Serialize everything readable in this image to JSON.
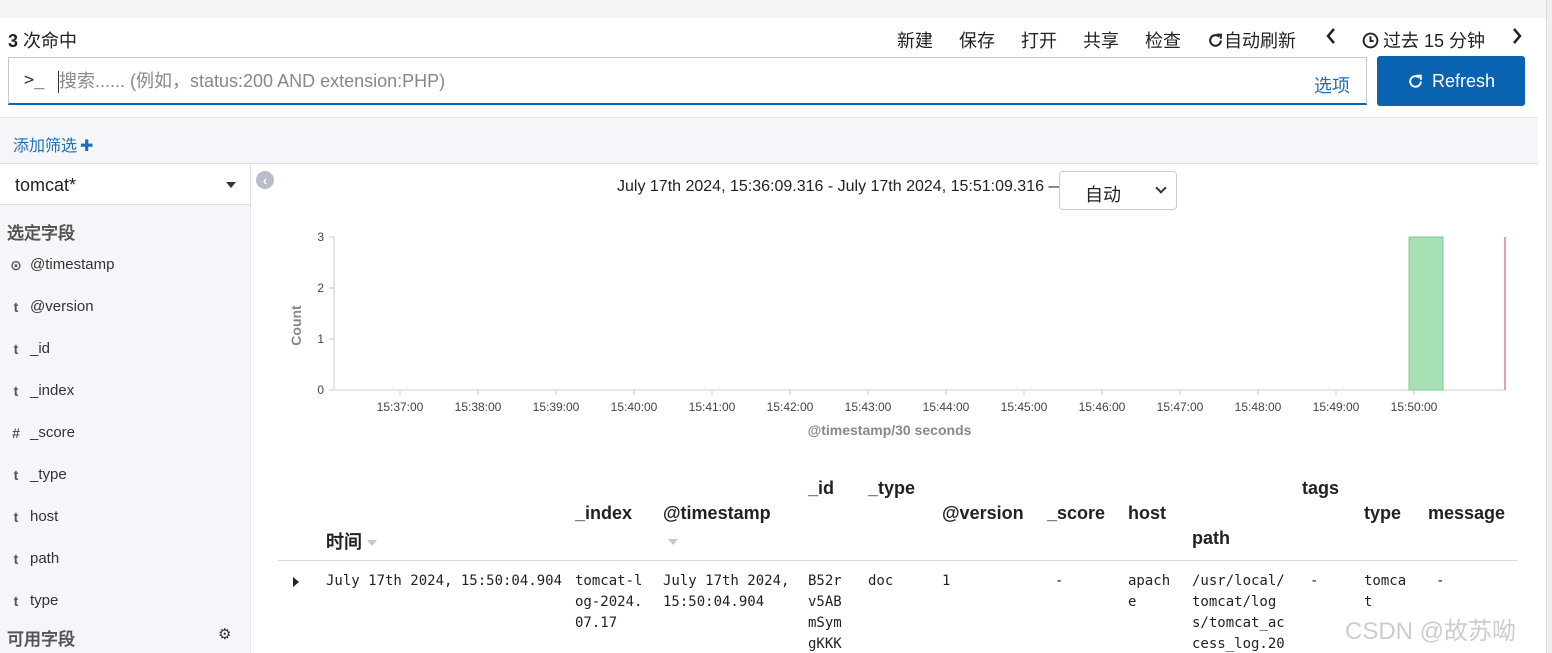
{
  "header": {
    "hits_count": "3",
    "hits_label": " 次命中",
    "menu": {
      "new": "新建",
      "save": "保存",
      "open": "打开",
      "share": "共享",
      "inspect": "检查",
      "auto_refresh": "自动刷新",
      "time_range": "过去 15 分钟"
    }
  },
  "search": {
    "prompt": ">_",
    "placeholder": "搜索...... (例如，status:200 AND extension:PHP)",
    "value": "",
    "options_label": "选项",
    "refresh_label": "Refresh"
  },
  "filters": {
    "add_label": "添加筛选",
    "add_icon": "plus-icon"
  },
  "sidebar": {
    "index_pattern": "tomcat*",
    "selected_heading": "选定字段",
    "available_heading": "可用字段",
    "fields": [
      {
        "type_icon": "⊙",
        "name": "@timestamp"
      },
      {
        "type_icon": "t",
        "name": "@version"
      },
      {
        "type_icon": "t",
        "name": "_id"
      },
      {
        "type_icon": "t",
        "name": "_index"
      },
      {
        "type_icon": "#",
        "name": "_score"
      },
      {
        "type_icon": "t",
        "name": "_type"
      },
      {
        "type_icon": "t",
        "name": "host"
      },
      {
        "type_icon": "t",
        "name": "path"
      },
      {
        "type_icon": "t",
        "name": "type"
      }
    ]
  },
  "histogram": {
    "range_text": "July 17th 2024, 15:36:09.316 - July 17th 2024, 15:51:09.316 —",
    "interval": "自动"
  },
  "chart_data": {
    "type": "bar",
    "xlabel": "@timestamp/30 seconds",
    "ylabel": "Count",
    "ylim": [
      0,
      3
    ],
    "yticks": [
      0,
      1,
      2,
      3
    ],
    "x_ticks": [
      "15:37:00",
      "15:38:00",
      "15:39:00",
      "15:40:00",
      "15:41:00",
      "15:42:00",
      "15:43:00",
      "15:44:00",
      "15:45:00",
      "15:46:00",
      "15:47:00",
      "15:48:00",
      "15:49:00",
      "15:50:00"
    ],
    "bars": [
      {
        "x": "15:50:00",
        "value": 3
      }
    ],
    "bar_color": "#a8e0b6",
    "now_marker_color": "#e8a0a8",
    "grid": false
  },
  "table": {
    "columns": {
      "time": "时间",
      "index": "_index",
      "timestamp": "@timestamp",
      "id": "_id",
      "type_": "_type",
      "version": "@version",
      "score": "_score",
      "host": "host",
      "path": "path",
      "tags": "tags",
      "type": "type",
      "message": "message"
    },
    "rows": [
      {
        "time": "July 17th 2024, 15:50:04.904",
        "index": "tomcat-l\nog-2024.\n07.17",
        "timestamp": "July 17th 2024,\n15:50:04.904",
        "id": "B52r\nv5AB\nmSym\ngKKK",
        "type_": "doc",
        "version": "1",
        "score": "-",
        "host": "apach\ne",
        "path": "/usr/local/\ntomcat/log\ns/tomcat_ac\ncess_log.20",
        "tags": "-",
        "type": "tomca\nt",
        "message": "-"
      }
    ]
  },
  "watermark": "CSDN @故苏呦"
}
